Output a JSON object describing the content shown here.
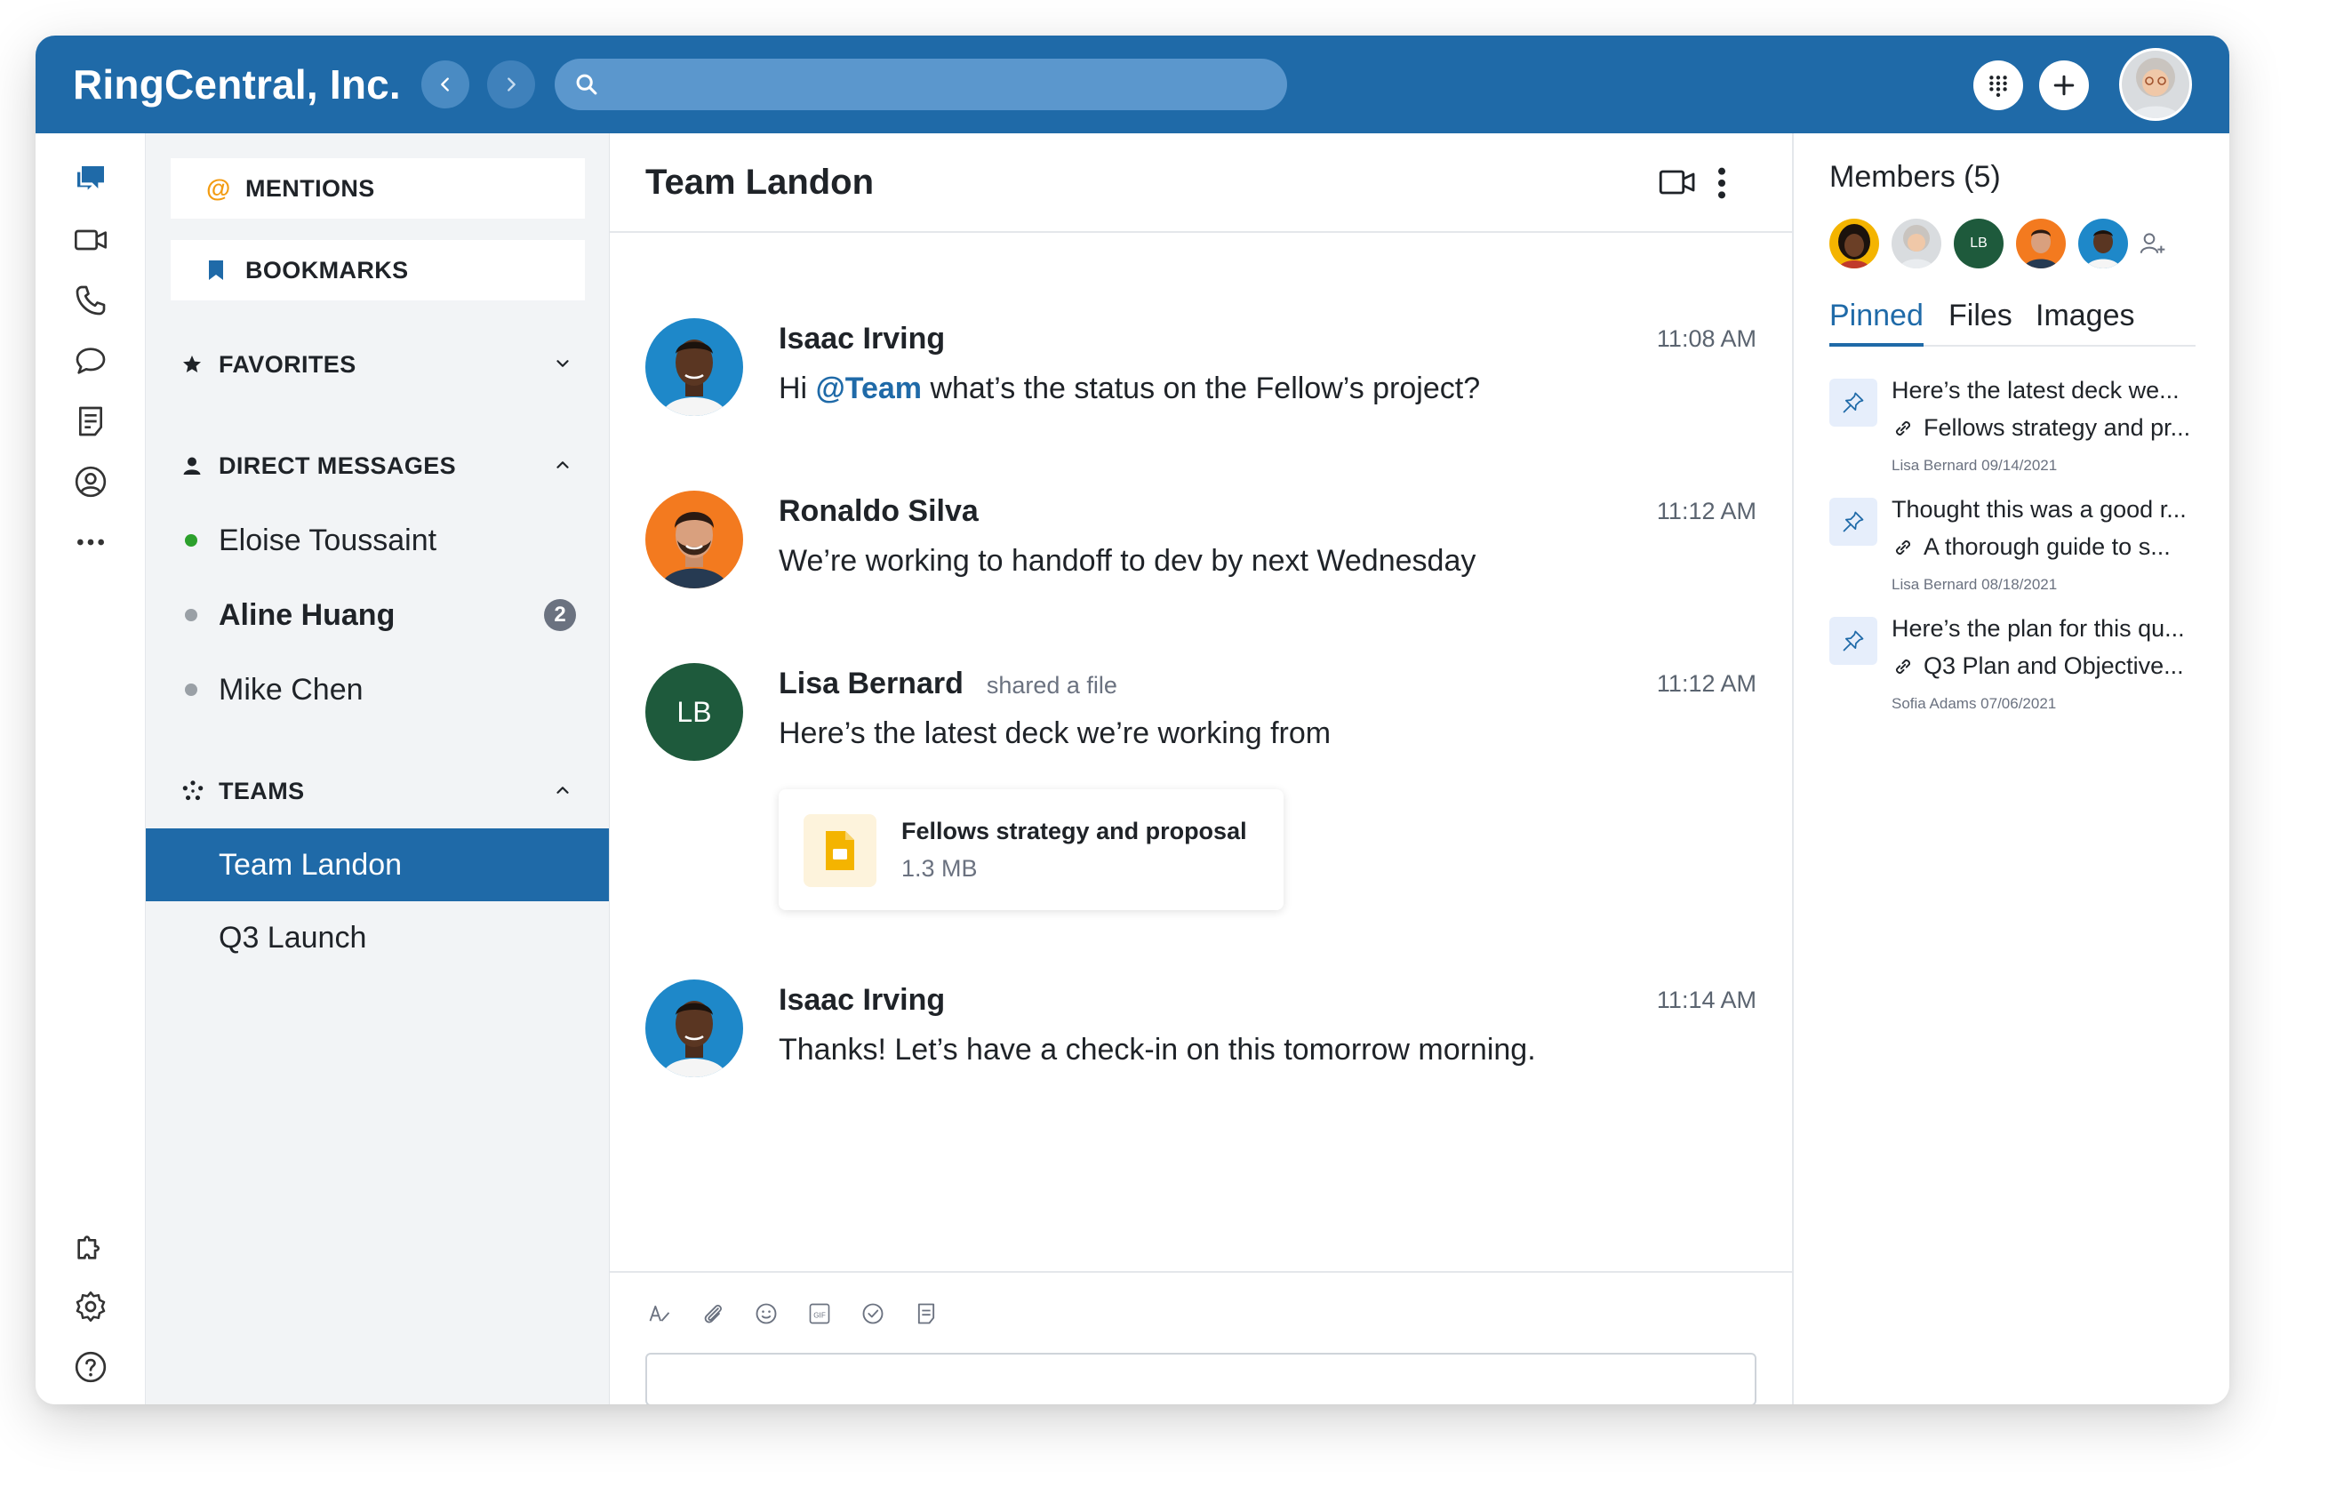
{
  "header": {
    "brand": "RingCentral, Inc.",
    "search_placeholder": ""
  },
  "nav": {
    "mentions_label": "MENTIONS",
    "bookmarks_label": "BOOKMARKS",
    "favorites_label": "FAVORITES",
    "direct_messages_label": "DIRECT MESSAGES",
    "direct_messages": [
      {
        "name": "Eloise Toussaint",
        "status_color": "#2ca02c",
        "unread": ""
      },
      {
        "name": "Aline Huang",
        "status_color": "#9aa0a6",
        "unread": "2"
      },
      {
        "name": "Mike Chen",
        "status_color": "#9aa0a6",
        "unread": ""
      }
    ],
    "teams_label": "TEAMS",
    "teams": [
      {
        "name": "Team Landon",
        "active": true
      },
      {
        "name": "Q3 Launch",
        "active": false
      }
    ]
  },
  "conversation": {
    "title": "Team Landon",
    "messages": [
      {
        "author": "Isaac Irving",
        "time": "11:08 AM",
        "mention": "@Team",
        "text": " what’s the status on the Fellow’s project?",
        "prefix": "Hi "
      },
      {
        "author": "Ronaldo Silva",
        "time": "11:12 AM",
        "text": "We’re working to handoff to dev by next Wednesday"
      },
      {
        "author": "Lisa Bernard",
        "initials": "LB",
        "action": "shared a file",
        "time": "11:12 AM",
        "text": "Here’s the latest deck we’re working from",
        "file": {
          "name": "Fellows strategy and proposal",
          "size": "1.3 MB"
        }
      },
      {
        "author": "Isaac Irving",
        "time": "11:14 AM",
        "text": "Thanks! Let’s have a check-in on this tomorrow morning."
      }
    ],
    "composer_placeholder": ""
  },
  "side": {
    "members_title": "Members (5)",
    "member_initials_lb": "LB",
    "tabs": [
      "Pinned",
      "Files",
      "Images"
    ],
    "pinned": [
      {
        "title": "Here’s the latest deck we...",
        "link": "Fellows strategy and pr...",
        "meta": "Lisa Bernard 09/14/2021"
      },
      {
        "title": "Thought this was a good r...",
        "link": "A thorough guide to s...",
        "meta": "Lisa Bernard 08/18/2021"
      },
      {
        "title": "Here’s the plan for this qu...",
        "link": "Q3 Plan and Objective...",
        "meta": "Sofia Adams 07/06/2021"
      }
    ]
  },
  "colors": {
    "brand_blue": "#1f6aa8",
    "lb_green": "#1e5a3c",
    "file_yellow": "#f4b400",
    "online_green": "#2ca02c"
  },
  "icons": [
    "message-icon",
    "video-icon",
    "phone-icon",
    "chat-bubble-icon",
    "notes-icon",
    "contacts-icon",
    "more-icon",
    "apps-icon",
    "settings-icon",
    "help-icon",
    "dialpad-icon",
    "plus-icon",
    "search-icon",
    "pin-icon",
    "link-icon",
    "add-member-icon"
  ]
}
